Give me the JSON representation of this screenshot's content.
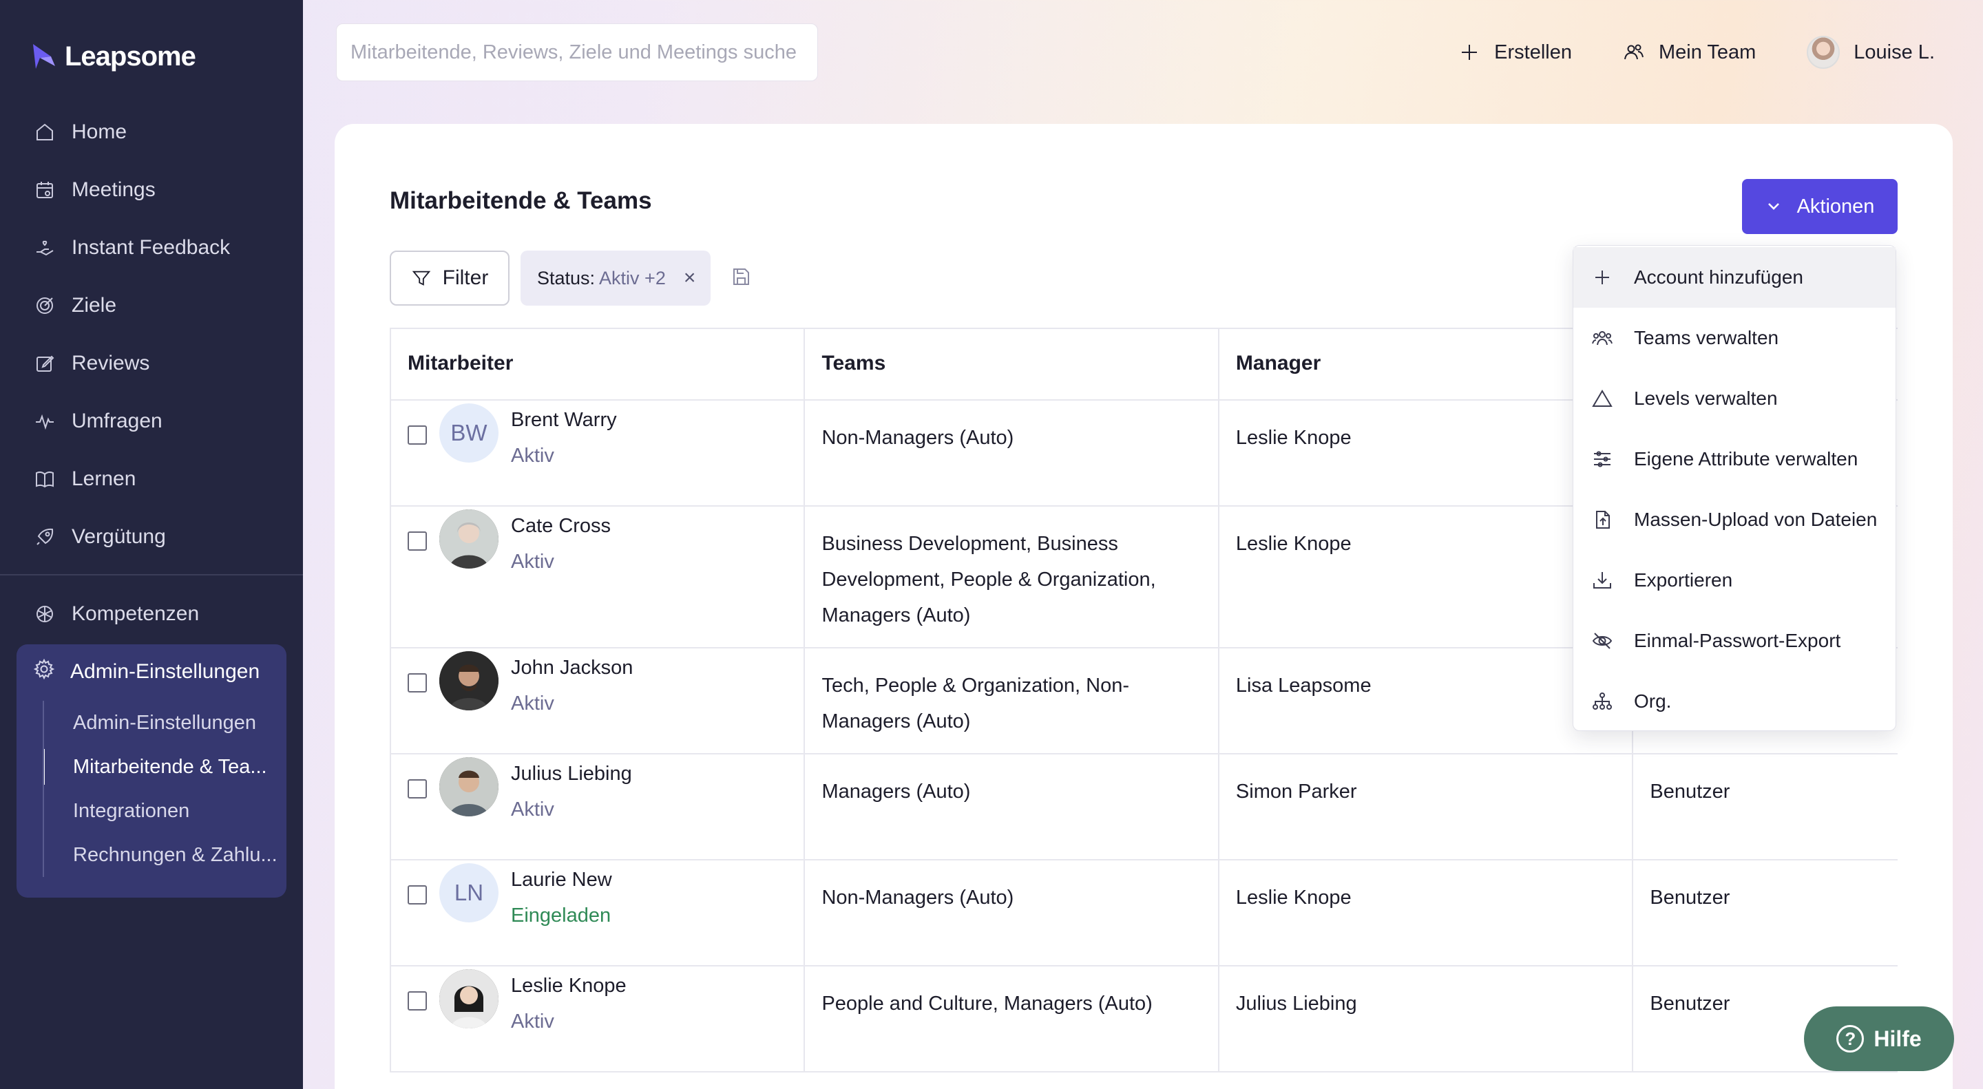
{
  "app": {
    "brand": "Leapsome"
  },
  "sidebar": {
    "items": [
      {
        "label": "Home",
        "icon": "home-icon"
      },
      {
        "label": "Meetings",
        "icon": "calendar-icon"
      },
      {
        "label": "Instant Feedback",
        "icon": "hand-heart-icon"
      },
      {
        "label": "Ziele",
        "icon": "target-icon"
      },
      {
        "label": "Reviews",
        "icon": "edit-icon"
      },
      {
        "label": "Umfragen",
        "icon": "pulse-icon"
      },
      {
        "label": "Lernen",
        "icon": "book-icon"
      },
      {
        "label": "Vergütung",
        "icon": "rocket-icon"
      }
    ],
    "kompetenzen": "Kompetenzen",
    "admin": {
      "label": "Admin-Einstellungen",
      "sub": [
        "Admin-Einstellungen",
        "Mitarbeitende & Tea...",
        "Integrationen",
        "Rechnungen & Zahlu..."
      ]
    }
  },
  "topbar": {
    "search_placeholder": "Mitarbeitende, Reviews, Ziele und Meetings suche",
    "create": "Erstellen",
    "team": "Mein Team",
    "user": "Louise L."
  },
  "page": {
    "title": "Mitarbeitende & Teams",
    "actions": "Aktionen",
    "filter": "Filter",
    "chip_key": "Status:",
    "chip_val": "Aktiv +2",
    "chip_close": "×"
  },
  "table": {
    "headers": [
      "Mitarbeiter",
      "Teams",
      "Manager",
      ""
    ],
    "rows": [
      {
        "initials": "BW",
        "name": "Brent Warry",
        "status": "Aktiv",
        "teams": "Non-Managers (Auto)",
        "manager": "Leslie Knope",
        "role": ""
      },
      {
        "initials": "",
        "name": "Cate Cross",
        "status": "Aktiv",
        "teams": "Business Development, Business Development, People & Organization, Managers (Auto)",
        "manager": "Leslie Knope",
        "role": ""
      },
      {
        "initials": "",
        "name": "John Jackson",
        "status": "Aktiv",
        "teams": "Tech, People & Organization, Non-Managers (Auto)",
        "manager": "Lisa Leapsome",
        "role": ""
      },
      {
        "initials": "",
        "name": "Julius Liebing",
        "status": "Aktiv",
        "teams": "Managers (Auto)",
        "manager": "Simon Parker",
        "role": "Benutzer"
      },
      {
        "initials": "LN",
        "name": "Laurie New",
        "status": "Eingeladen",
        "teams": "Non-Managers (Auto)",
        "manager": "Leslie Knope",
        "role": "Benutzer"
      },
      {
        "initials": "",
        "name": "Leslie Knope",
        "status": "Aktiv",
        "teams": "People and Culture, Managers (Auto)",
        "manager": "Julius Liebing",
        "role": "Benutzer"
      }
    ]
  },
  "dropdown": {
    "items": [
      {
        "label": "Account hinzufügen",
        "icon": "plus-icon"
      },
      {
        "label": "Teams verwalten",
        "icon": "users-icon"
      },
      {
        "label": "Levels verwalten",
        "icon": "triangle-icon"
      },
      {
        "label": "Eigene Attribute verwalten",
        "icon": "sliders-icon"
      },
      {
        "label": "Massen-Upload von Dateien",
        "icon": "file-upload-icon"
      },
      {
        "label": "Exportieren",
        "icon": "download-icon"
      },
      {
        "label": "Einmal-Passwort-Export",
        "icon": "eye-off-icon"
      },
      {
        "label": "Org.",
        "icon": "org-chart-icon"
      }
    ]
  },
  "help": {
    "label": "Hilfe",
    "q": "?"
  },
  "colors": {
    "sidebar": "#242640",
    "accent": "#5548e0",
    "help": "#4b7a68",
    "invited": "#2f8a56"
  }
}
